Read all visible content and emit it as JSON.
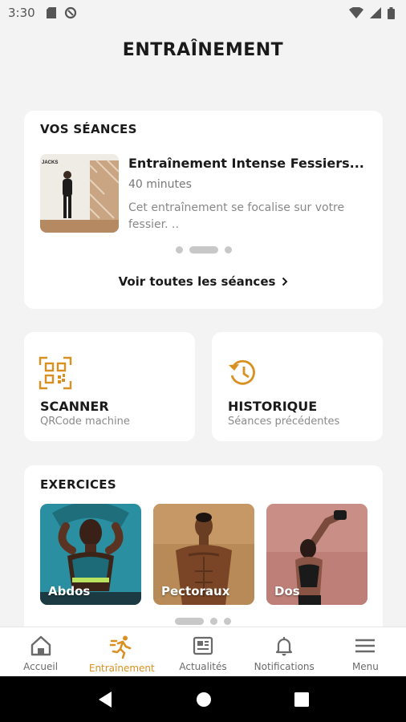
{
  "status_bar": {
    "time": "3:30"
  },
  "page": {
    "title": "ENTRAÎNEMENT"
  },
  "sessions": {
    "heading": "VOS SÉANCES",
    "items": [
      {
        "thumb_caption": "JACKS",
        "title": "Entraînement Intense Fessiers...",
        "duration": "40 minutes",
        "description": "Cet entraînement se focalise sur votre fessier. .."
      }
    ],
    "see_all_label": "Voir toutes les séances"
  },
  "actions": {
    "scanner": {
      "title": "SCANNER",
      "subtitle": "QRCode machine"
    },
    "history": {
      "title": "HISTORIQUE",
      "subtitle": "Séances précédentes"
    }
  },
  "exercises": {
    "heading": "EXERCICES",
    "items": [
      {
        "label": "Abdos"
      },
      {
        "label": "Pectoraux"
      },
      {
        "label": "Dos"
      }
    ]
  },
  "bottom_nav": {
    "items": [
      {
        "label": "Accueil",
        "icon": "home-icon"
      },
      {
        "label": "Entraînement",
        "icon": "running-icon"
      },
      {
        "label": "Actualités",
        "icon": "news-icon"
      },
      {
        "label": "Notifications",
        "icon": "bell-icon"
      },
      {
        "label": "Menu",
        "icon": "menu-icon"
      }
    ],
    "active_index": 1
  },
  "colors": {
    "accent": "#d99021",
    "background": "#f3f3f3",
    "card": "#ffffff"
  }
}
